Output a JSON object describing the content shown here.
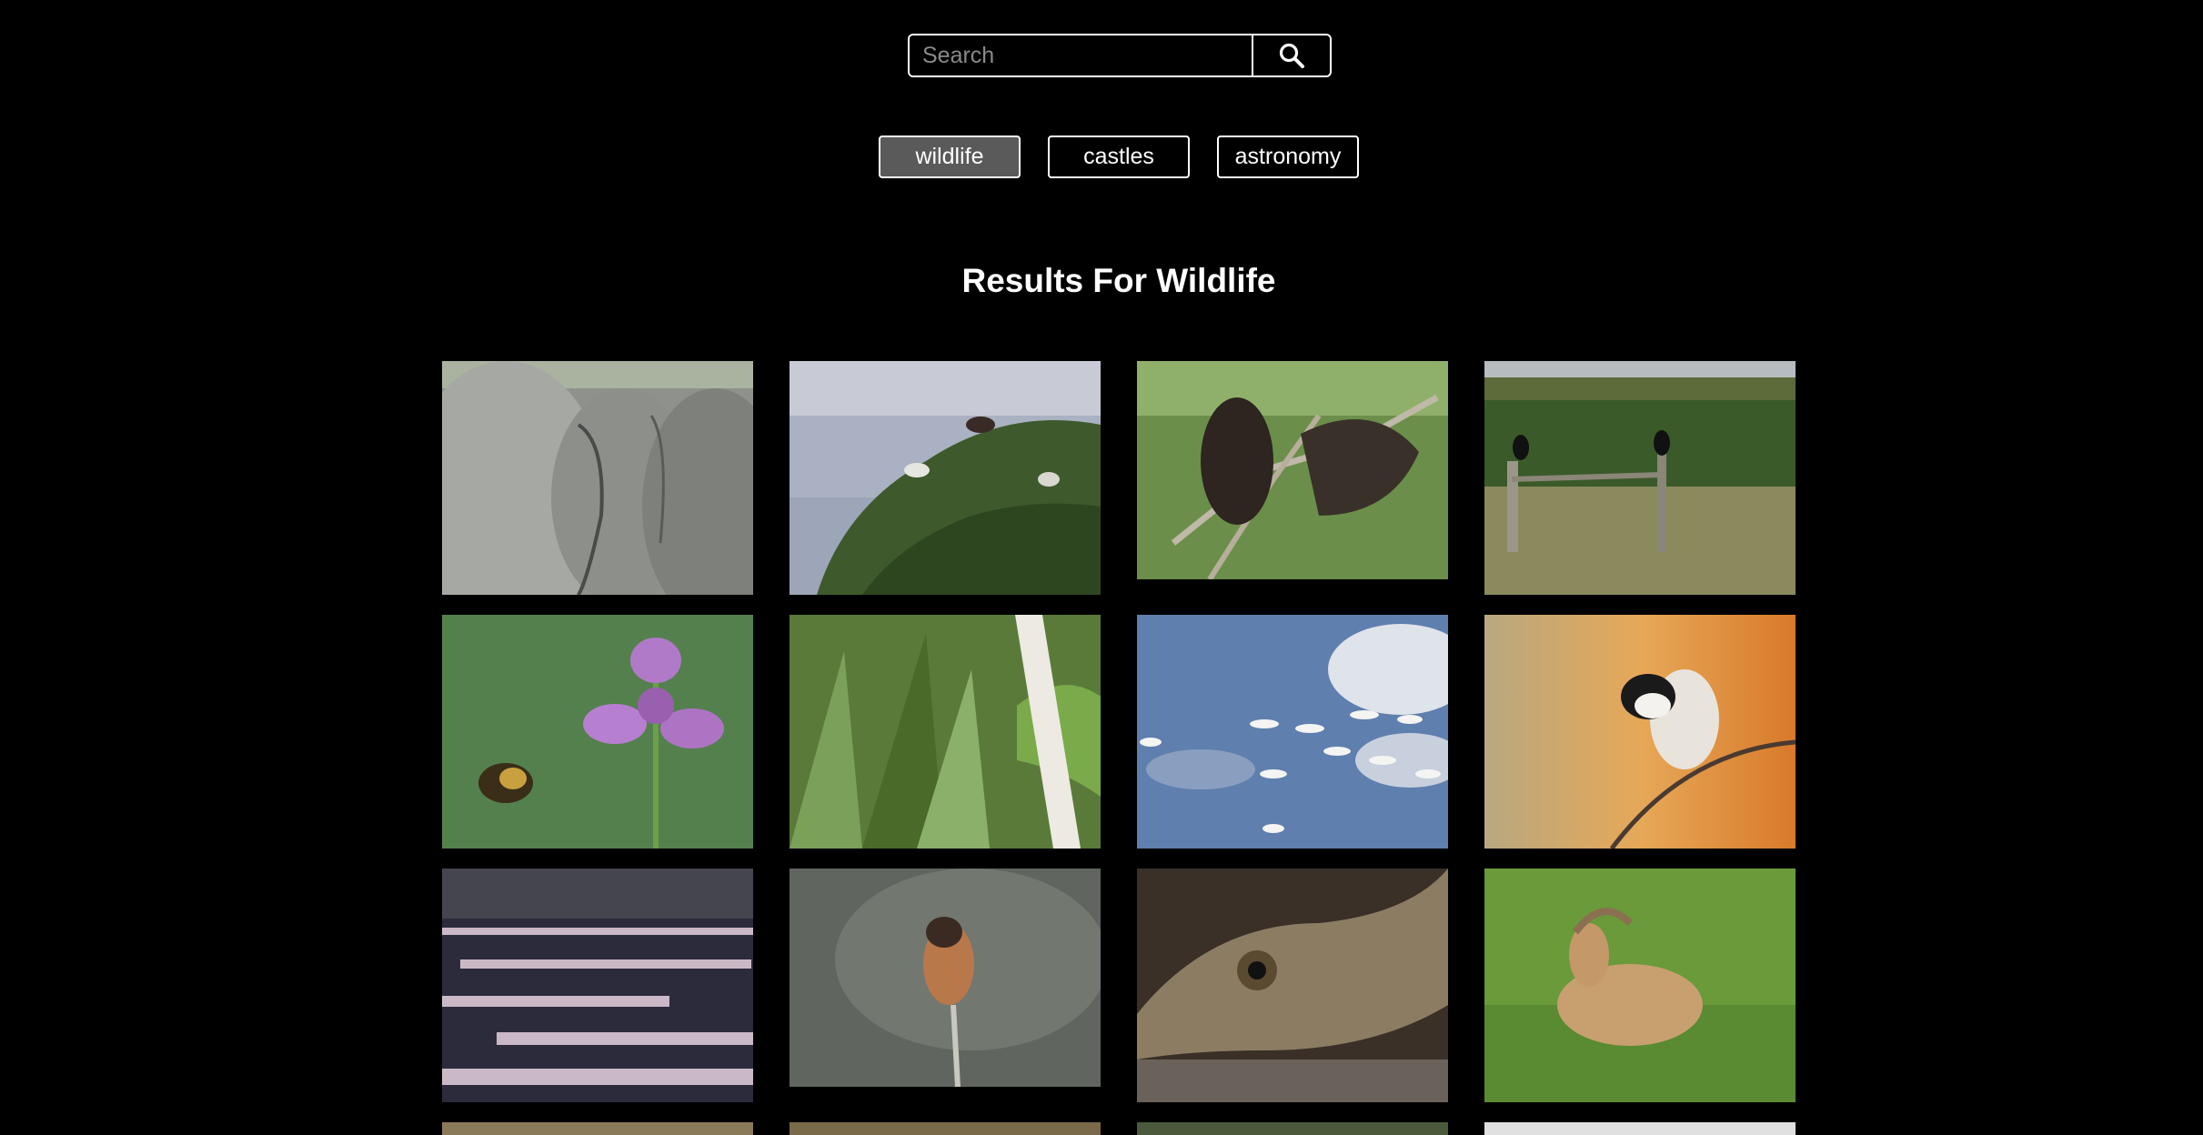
{
  "search": {
    "placeholder": "Search",
    "button_icon": "search-icon"
  },
  "tags": [
    {
      "label": "wildlife",
      "active": true
    },
    {
      "label": "castles",
      "active": false
    },
    {
      "label": "astronomy",
      "active": false
    }
  ],
  "heading": "Results For Wildlife",
  "results": [
    {
      "subject": "elephants",
      "colors": [
        "#9a9c98",
        "#7f817e"
      ]
    },
    {
      "subject": "ibises on shrub by water",
      "colors": [
        "#c7ccd9",
        "#3d5a2a"
      ]
    },
    {
      "subject": "dark birds in tree",
      "colors": [
        "#7aa05a",
        "#3a2e28"
      ]
    },
    {
      "subject": "birds on fence in field",
      "colors": [
        "#3c5a2a",
        "#8a8a5a"
      ]
    },
    {
      "subject": "bee and purple flower",
      "colors": [
        "#4f7a4a",
        "#b07ac8"
      ]
    },
    {
      "subject": "grass with measuring stick",
      "colors": [
        "#5a7a3a",
        "#e8e8e0"
      ]
    },
    {
      "subject": "pelicans flying",
      "colors": [
        "#5a7aa8",
        "#d8dde8"
      ]
    },
    {
      "subject": "chickadee on branch",
      "colors": [
        "#d08a40",
        "#f0c070"
      ]
    },
    {
      "subject": "birds on mudflat",
      "colors": [
        "#2a2a3a",
        "#c9b8c8"
      ]
    },
    {
      "subject": "small bird on stick",
      "colors": [
        "#5a605a",
        "#a8a8a0"
      ]
    },
    {
      "subject": "gecko",
      "colors": [
        "#8a7a60",
        "#3a3028"
      ]
    },
    {
      "subject": "goat lying on grass",
      "colors": [
        "#6a9a3a",
        "#c8a070"
      ]
    },
    {
      "subject": "partial",
      "colors": [
        "#8a7a5a",
        "#6a5a3a"
      ]
    },
    {
      "subject": "partial",
      "colors": [
        "#7a6a4a",
        "#5a4a30"
      ]
    },
    {
      "subject": "partial",
      "colors": [
        "#4a5a3a",
        "#6a7a4a"
      ]
    },
    {
      "subject": "partial",
      "colors": [
        "#e0e0e0",
        "#c8c8c8"
      ]
    }
  ]
}
